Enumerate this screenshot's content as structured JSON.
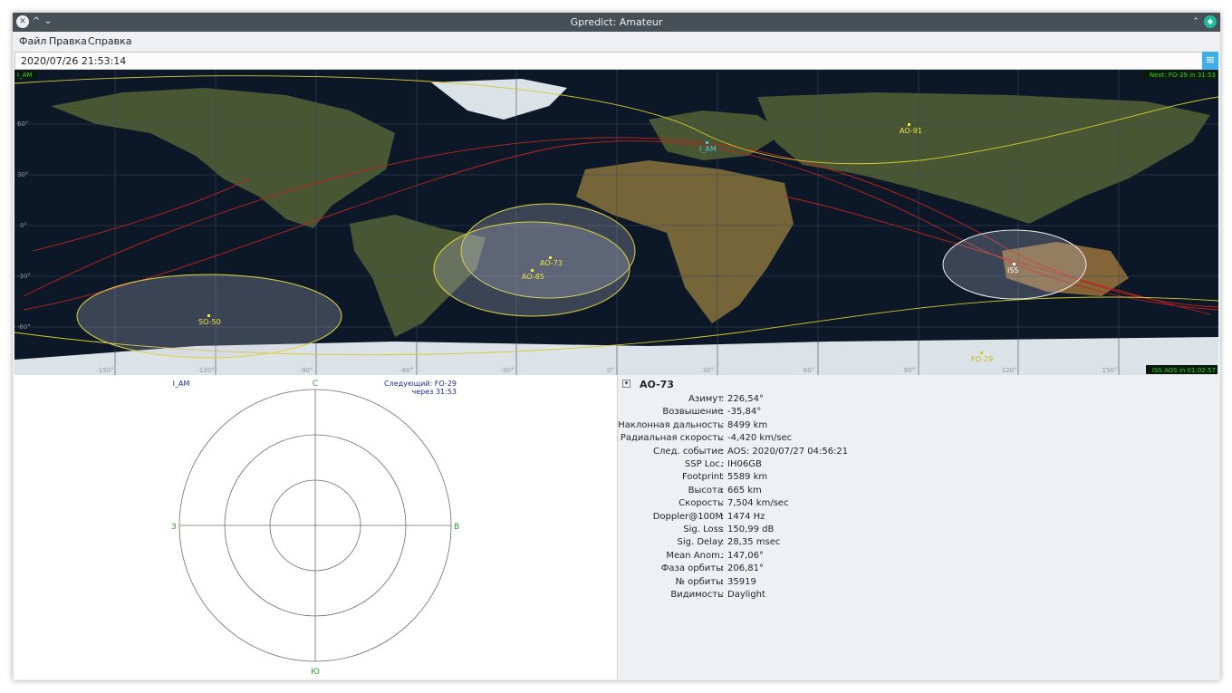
{
  "window": {
    "title": "Gpredict: Amateur"
  },
  "menu": [
    "Файл",
    "Правка",
    "Справка"
  ],
  "datetime": "2020/07/26 21:53:14",
  "map": {
    "qth_label": "I_AM",
    "next_event": "Next: FO-29 in 31:53",
    "iss_aos": "ISS AOS in 01:02:57",
    "lat_labels": [
      "60°",
      "30°",
      "0°",
      "-30°",
      "-60°"
    ],
    "lon_labels": [
      "-150°",
      "-120°",
      "-90°",
      "-60°",
      "-30°",
      "0°",
      "30°",
      "60°",
      "90°",
      "120°",
      "150°"
    ],
    "satellites": [
      {
        "name": "AO-91",
        "color": "#f4e542"
      },
      {
        "name": "I_AM",
        "color": "#39d3d3"
      },
      {
        "name": "AO-73",
        "color": "#f4e542"
      },
      {
        "name": "AO-85",
        "color": "#f4e542"
      },
      {
        "name": "SO-50",
        "color": "#f4e542"
      },
      {
        "name": "ISS",
        "color": "#ffffff"
      },
      {
        "name": "FO-29",
        "color": "#f4e542"
      }
    ]
  },
  "polar": {
    "qth": "I_AM",
    "next_line1": "Следующий: FO-29",
    "next_line2": "через 31:53",
    "north": "С",
    "south": "Ю",
    "west": "З",
    "east": "В"
  },
  "info": {
    "title": "AO-73",
    "rows": [
      {
        "label": "Азимут",
        "value": "226,54°"
      },
      {
        "label": "Возвышение",
        "value": "-35,84°"
      },
      {
        "label": "Наклонная дальность",
        "value": "8499 km"
      },
      {
        "label": "Радиальная скорость",
        "value": "-4,420 km/sec"
      },
      {
        "label": "След. событие",
        "value": "AOS: 2020/07/27 04:56:21"
      },
      {
        "label": "SSP Loc.",
        "value": "IH06GB"
      },
      {
        "label": "Footprint",
        "value": "5589 km"
      },
      {
        "label": "Высота",
        "value": "665 km"
      },
      {
        "label": "Скорость",
        "value": "7,504 km/sec"
      },
      {
        "label": "Doppler@100M",
        "value": "1474 Hz"
      },
      {
        "label": "Sig. Loss",
        "value": "150,99 dB"
      },
      {
        "label": "Sig. Delay",
        "value": "28,35 msec"
      },
      {
        "label": "Mean Anom.",
        "value": "147,06°"
      },
      {
        "label": "Фаза орбиты",
        "value": "206,81°"
      },
      {
        "label": "№ орбиты",
        "value": "35919"
      },
      {
        "label": "Видимость",
        "value": "Daylight"
      }
    ]
  }
}
